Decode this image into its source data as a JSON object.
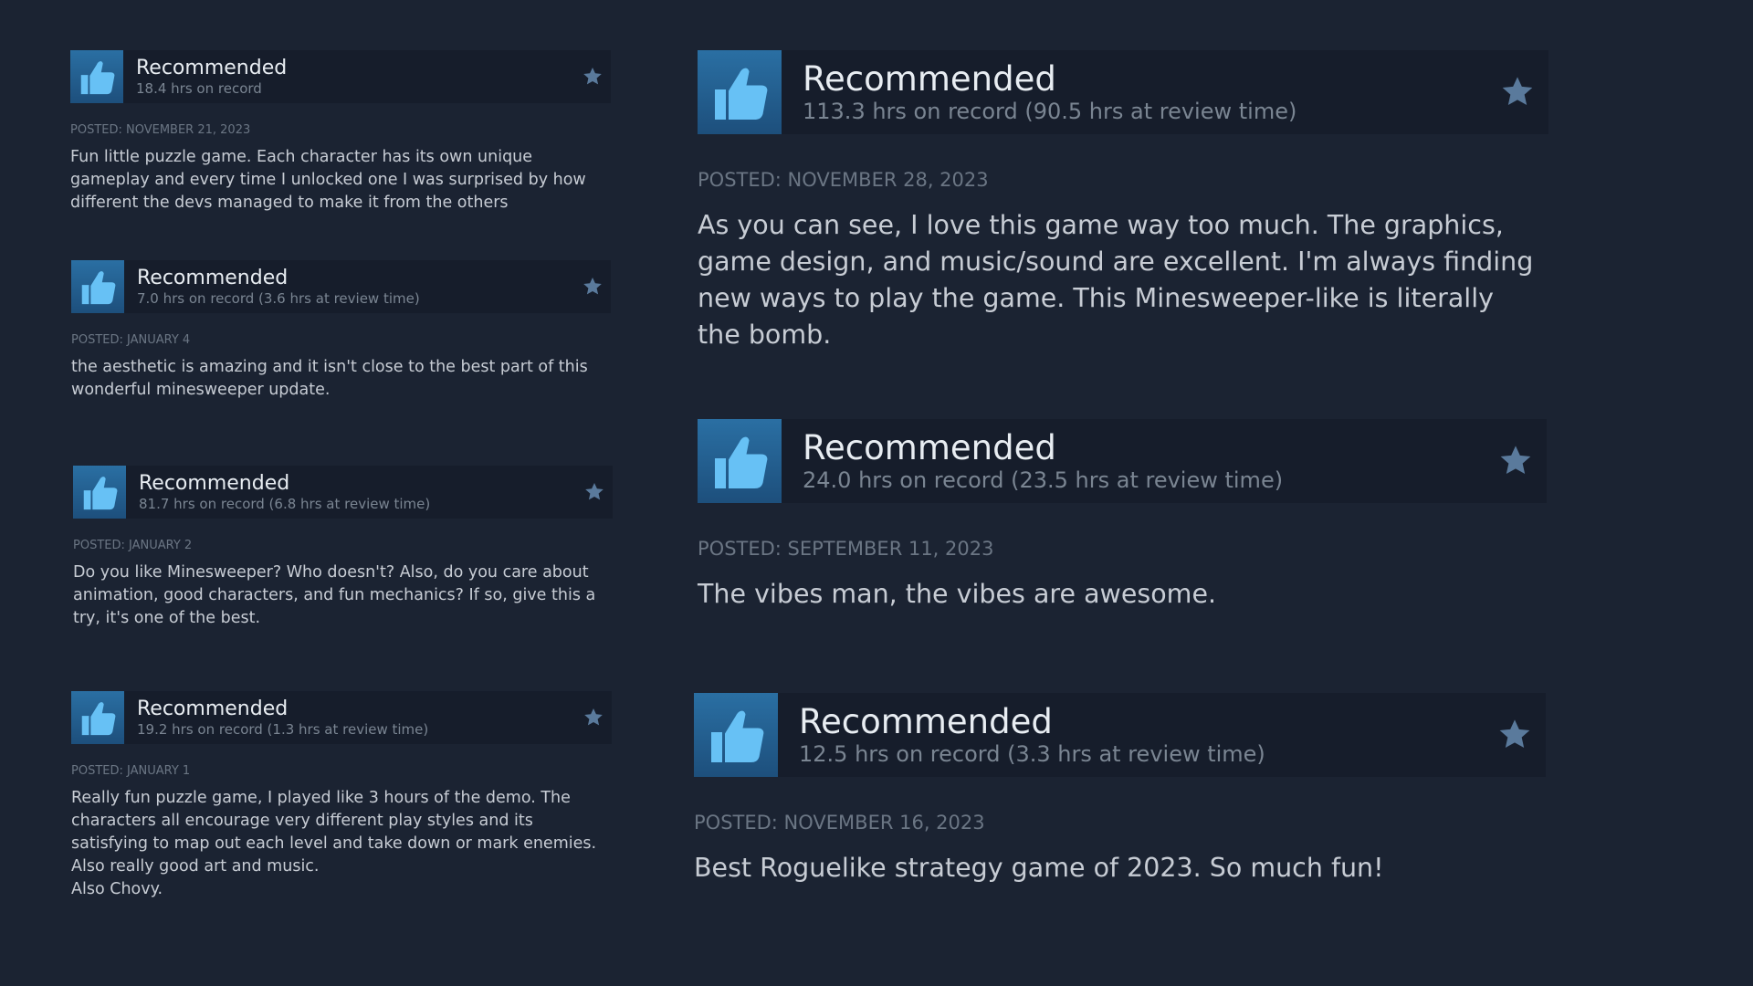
{
  "left_reviews": [
    {
      "verdict": "Recommended",
      "hours": "18.4 hrs on record",
      "posted": "POSTED: NOVEMBER 21, 2023",
      "text": "Fun little puzzle game. Each character has its own unique gameplay and every time I unlocked one I was surprised by how different the devs managed to make it from the others",
      "icon": "thumbs-up-icon",
      "action_icon": "star-icon"
    },
    {
      "verdict": "Recommended",
      "hours": "7.0 hrs on record (3.6 hrs at review time)",
      "posted": "POSTED: JANUARY 4",
      "text": "the aesthetic is amazing and it isn't close to the best part of this wonderful minesweeper update.",
      "icon": "thumbs-up-icon",
      "action_icon": "star-icon"
    },
    {
      "verdict": "Recommended",
      "hours": "81.7 hrs on record (6.8 hrs at review time)",
      "posted": "POSTED: JANUARY 2",
      "text": "Do you like Minesweeper? Who doesn't? Also, do you care about animation, good characters, and fun mechanics? If so, give this a try, it's one of the best.",
      "icon": "thumbs-up-icon",
      "action_icon": "star-icon"
    },
    {
      "verdict": "Recommended",
      "hours": "19.2 hrs on record (1.3 hrs at review time)",
      "posted": "POSTED: JANUARY 1",
      "text": "Really fun puzzle game, I played like 3 hours of the demo. The characters all encourage very different play styles and its satisfying to map out each level and take down or mark enemies. Also really good art and music.\nAlso Chovy.",
      "icon": "thumbs-up-icon",
      "action_icon": "star-icon"
    }
  ],
  "right_reviews": [
    {
      "verdict": "Recommended",
      "hours": "113.3 hrs on record (90.5 hrs at review time)",
      "posted": "POSTED: NOVEMBER 28, 2023",
      "text": "As you can see, I love this game way too much. The graphics, game design, and music/sound are excellent. I'm always finding new ways to play the game. This Minesweeper-like is literally the bomb.",
      "icon": "thumbs-up-icon",
      "action_icon": "star-icon"
    },
    {
      "verdict": "Recommended",
      "hours": "24.0 hrs on record (23.5 hrs at review time)",
      "posted": "POSTED: SEPTEMBER 11, 2023",
      "text": "The vibes man, the vibes are awesome.",
      "icon": "thumbs-up-icon",
      "action_icon": "star-icon"
    },
    {
      "verdict": "Recommended",
      "hours": "12.5 hrs on record (3.3 hrs at review time)",
      "posted": "POSTED: NOVEMBER 16, 2023",
      "text": "Best Roguelike strategy game of 2023. So much fun!",
      "icon": "thumbs-up-icon",
      "action_icon": "star-icon"
    }
  ],
  "colors": {
    "background": "#1b2332",
    "header": "#161d2b",
    "thumb_bg": "#2a6fa3",
    "thumb_fg": "#67c1f5",
    "star": "#5a7a9c"
  }
}
